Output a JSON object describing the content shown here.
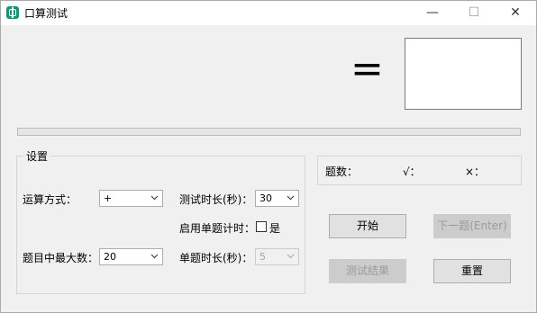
{
  "window": {
    "title": "口算测试",
    "minimize": "—",
    "maximize": "☐",
    "close": "✕"
  },
  "question": {
    "equals": "=",
    "answer": ""
  },
  "progress": {
    "value": 0
  },
  "settings": {
    "group_title": "设置",
    "operation_label": "运算方式：",
    "operation_value": "+",
    "duration_label": "测试时长(秒)：",
    "duration_value": "30",
    "single_timer_label": "启用单题计时：",
    "single_timer_checkbox_label": "是",
    "single_timer_checked": false,
    "max_label": "题目中最大数：",
    "max_value": "20",
    "single_duration_label": "单题时长(秒)：",
    "single_duration_value": "5"
  },
  "stats": {
    "count_label": "题数：",
    "correct_label": "√：",
    "wrong_label": "×："
  },
  "buttons": {
    "start": "开始",
    "next": "下一题(Enter)",
    "results": "测试结果",
    "reset": "重置"
  },
  "icons": {
    "app": "calculator-app-icon",
    "dropdown": "chevron-down-icon"
  }
}
